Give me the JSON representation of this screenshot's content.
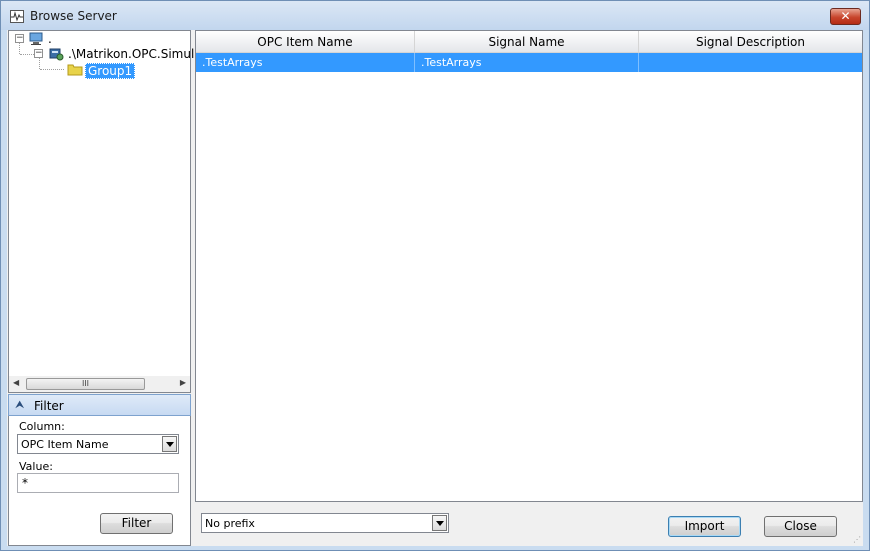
{
  "window": {
    "title": "Browse Server",
    "close_glyph": "✕"
  },
  "tree": {
    "root_label": ".",
    "server_label": ".\\Matrikon.OPC.Simulati",
    "group_label": "Group1",
    "expander_glyph": "−"
  },
  "scrollbar": {
    "left_arrow": "◀",
    "right_arrow": "▶",
    "thumb_grip": "III"
  },
  "filter": {
    "chevron": "⮝",
    "title": "Filter",
    "column_label": "Column:",
    "column_value": "OPC Item Name",
    "value_label": "Value:",
    "value": "*",
    "button_label": "Filter"
  },
  "grid": {
    "columns": [
      "OPC Item Name",
      "Signal Name",
      "Signal Description"
    ],
    "rows": [
      {
        "item": ".TestArrays",
        "signal": ".TestArrays",
        "description": ""
      }
    ]
  },
  "footer": {
    "prefix_value": "No prefix",
    "import_label": "Import",
    "close_label": "Close"
  },
  "colors": {
    "selection": "#3399ff",
    "title_bg": "#c9dcf0"
  }
}
